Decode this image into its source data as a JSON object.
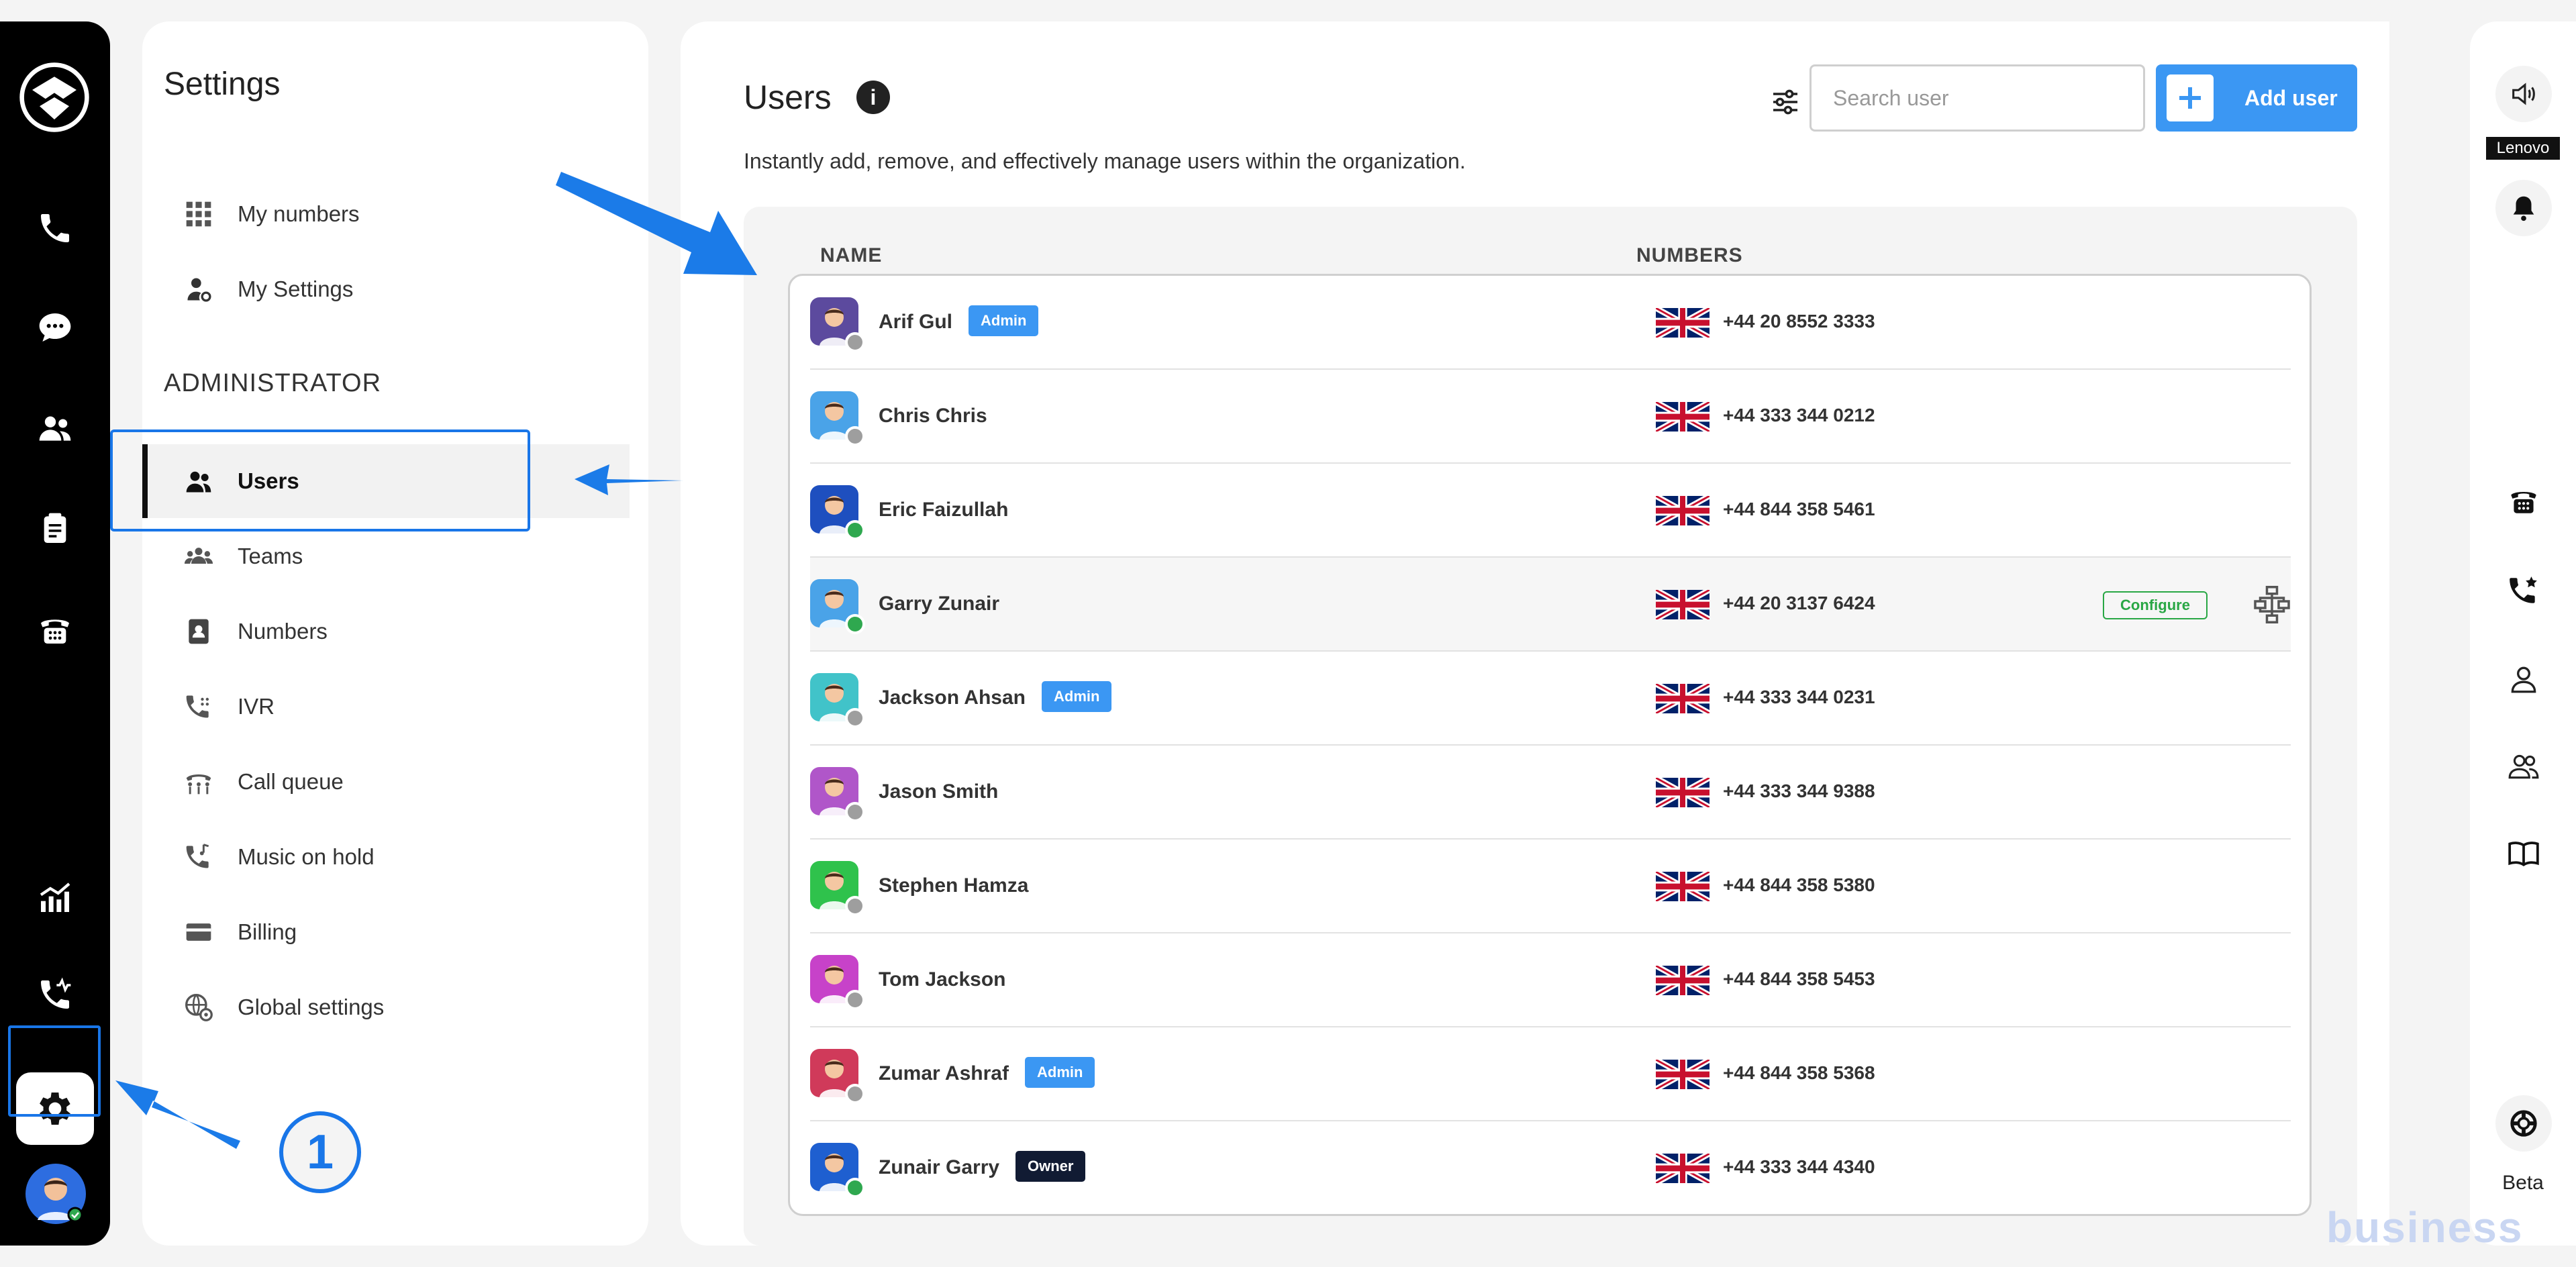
{
  "settings": {
    "title": "Settings",
    "section_admin": "ADMINISTRATOR",
    "items": [
      {
        "label": "My numbers",
        "icon": "grid-icon"
      },
      {
        "label": "My Settings",
        "icon": "user-settings-icon"
      },
      {
        "label": "Users",
        "icon": "users-icon",
        "active": true
      },
      {
        "label": "Teams",
        "icon": "teams-icon"
      },
      {
        "label": "Numbers",
        "icon": "contact-book-icon"
      },
      {
        "label": "IVR",
        "icon": "ivr-icon"
      },
      {
        "label": "Call queue",
        "icon": "call-queue-icon"
      },
      {
        "label": "Music on hold",
        "icon": "music-hold-icon"
      },
      {
        "label": "Billing",
        "icon": "card-icon"
      },
      {
        "label": "Global settings",
        "icon": "globe-gear-icon"
      }
    ]
  },
  "main": {
    "title": "Users",
    "info_glyph": "i",
    "subtitle": "Instantly add, remove, and effectively manage users within the organization.",
    "search_placeholder": "Search user",
    "add_user_label": "Add user",
    "columns": {
      "name": "NAME",
      "numbers": "NUMBERS"
    },
    "configure_label": "Configure",
    "users": [
      {
        "name": "Arif Gul",
        "badge": "Admin",
        "badge_type": "admin",
        "number": "+44 20 8552 3333",
        "status": "offline",
        "avatar_color": "#5c4a9e"
      },
      {
        "name": "Chris Chris",
        "badge": "",
        "badge_type": "",
        "number": "+44 333 344 0212",
        "status": "offline",
        "avatar_color": "#4aa3e8"
      },
      {
        "name": "Eric Faizullah",
        "badge": "",
        "badge_type": "",
        "number": "+44 844 358 5461",
        "status": "online",
        "avatar_color": "#1e4fbf"
      },
      {
        "name": "Garry Zunair",
        "badge": "",
        "badge_type": "",
        "number": "+44 20 3137 6424",
        "status": "online",
        "avatar_color": "#4aa3e8",
        "hover": true
      },
      {
        "name": "Jackson Ahsan",
        "badge": "Admin",
        "badge_type": "admin",
        "number": "+44 333 344 0231",
        "status": "offline",
        "avatar_color": "#41c3c9"
      },
      {
        "name": "Jason Smith",
        "badge": "",
        "badge_type": "",
        "number": "+44 333 344 9388",
        "status": "offline",
        "avatar_color": "#b056c9"
      },
      {
        "name": "Stephen Hamza",
        "badge": "",
        "badge_type": "",
        "number": "+44 844 358 5380",
        "status": "offline",
        "avatar_color": "#2fc24c"
      },
      {
        "name": "Tom Jackson",
        "badge": "",
        "badge_type": "",
        "number": "+44 844 358 5453",
        "status": "offline",
        "avatar_color": "#c742c9"
      },
      {
        "name": "Zumar Ashraf",
        "badge": "Admin",
        "badge_type": "admin",
        "number": "+44 844 358 5368",
        "status": "offline",
        "avatar_color": "#d03a5a"
      },
      {
        "name": "Zunair Garry",
        "badge": "Owner",
        "badge_type": "owner",
        "number": "+44 333 344 4340",
        "status": "online",
        "avatar_color": "#1e5fd0"
      }
    ]
  },
  "rightbar": {
    "device_label": "Lenovo",
    "beta_label": "Beta"
  },
  "annotation": {
    "step_number": "1"
  },
  "watermark": "business",
  "colors": {
    "accent": "#3b97f3",
    "highlight": "#1976e8",
    "online": "#2fa84f",
    "offline": "#9e9e9e",
    "configure": "#29a745"
  }
}
